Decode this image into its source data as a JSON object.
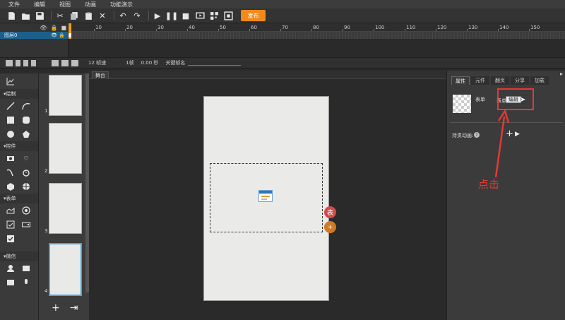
{
  "menu": [
    "文件",
    "编辑",
    "视图",
    "动画",
    "功能演示"
  ],
  "toolbar": {
    "icons": [
      "new-icon",
      "open-icon",
      "save-icon",
      "cut-icon",
      "copy-icon",
      "paste-icon",
      "delete-icon",
      "undo-icon",
      "redo-icon",
      "play-icon",
      "pause-icon",
      "stop-icon",
      "preview-icon",
      "qrcode-icon",
      "fullscreen-icon"
    ],
    "publish_label": "发布",
    "publish_color": "#f08a1c"
  },
  "timeline": {
    "layer_name": "图层0",
    "ruler_ticks": [
      "10",
      "20",
      "30",
      "40",
      "50",
      "60",
      "70",
      "80",
      "90",
      "100",
      "110",
      "120",
      "130",
      "140",
      "150"
    ],
    "frame_rate": "12 帧速",
    "frame": "1帧",
    "time": "0.00 秒",
    "keyframe_label": "关键帧名"
  },
  "tools": {
    "sections": [
      {
        "title": "绘制"
      },
      {
        "title": "控件"
      },
      {
        "title": "表单"
      },
      {
        "title": "微信"
      }
    ]
  },
  "thumbnails": [
    {
      "num": "1"
    },
    {
      "num": "2"
    },
    {
      "num": "3"
    },
    {
      "num": "4",
      "selected": true
    }
  ],
  "stage": {
    "tab": "舞台",
    "badge1": "表",
    "badge2": "+"
  },
  "right_panel": {
    "tabs": [
      "属性",
      "元件",
      "翻页",
      "分享",
      "加载"
    ],
    "active_tab": "属性",
    "prop_name": "表单",
    "field_label": "表单",
    "edit_button": "编辑",
    "trigger_label": "持贯动画:",
    "help": "?",
    "annotation": "点击",
    "annotation_color": "#e53935"
  }
}
